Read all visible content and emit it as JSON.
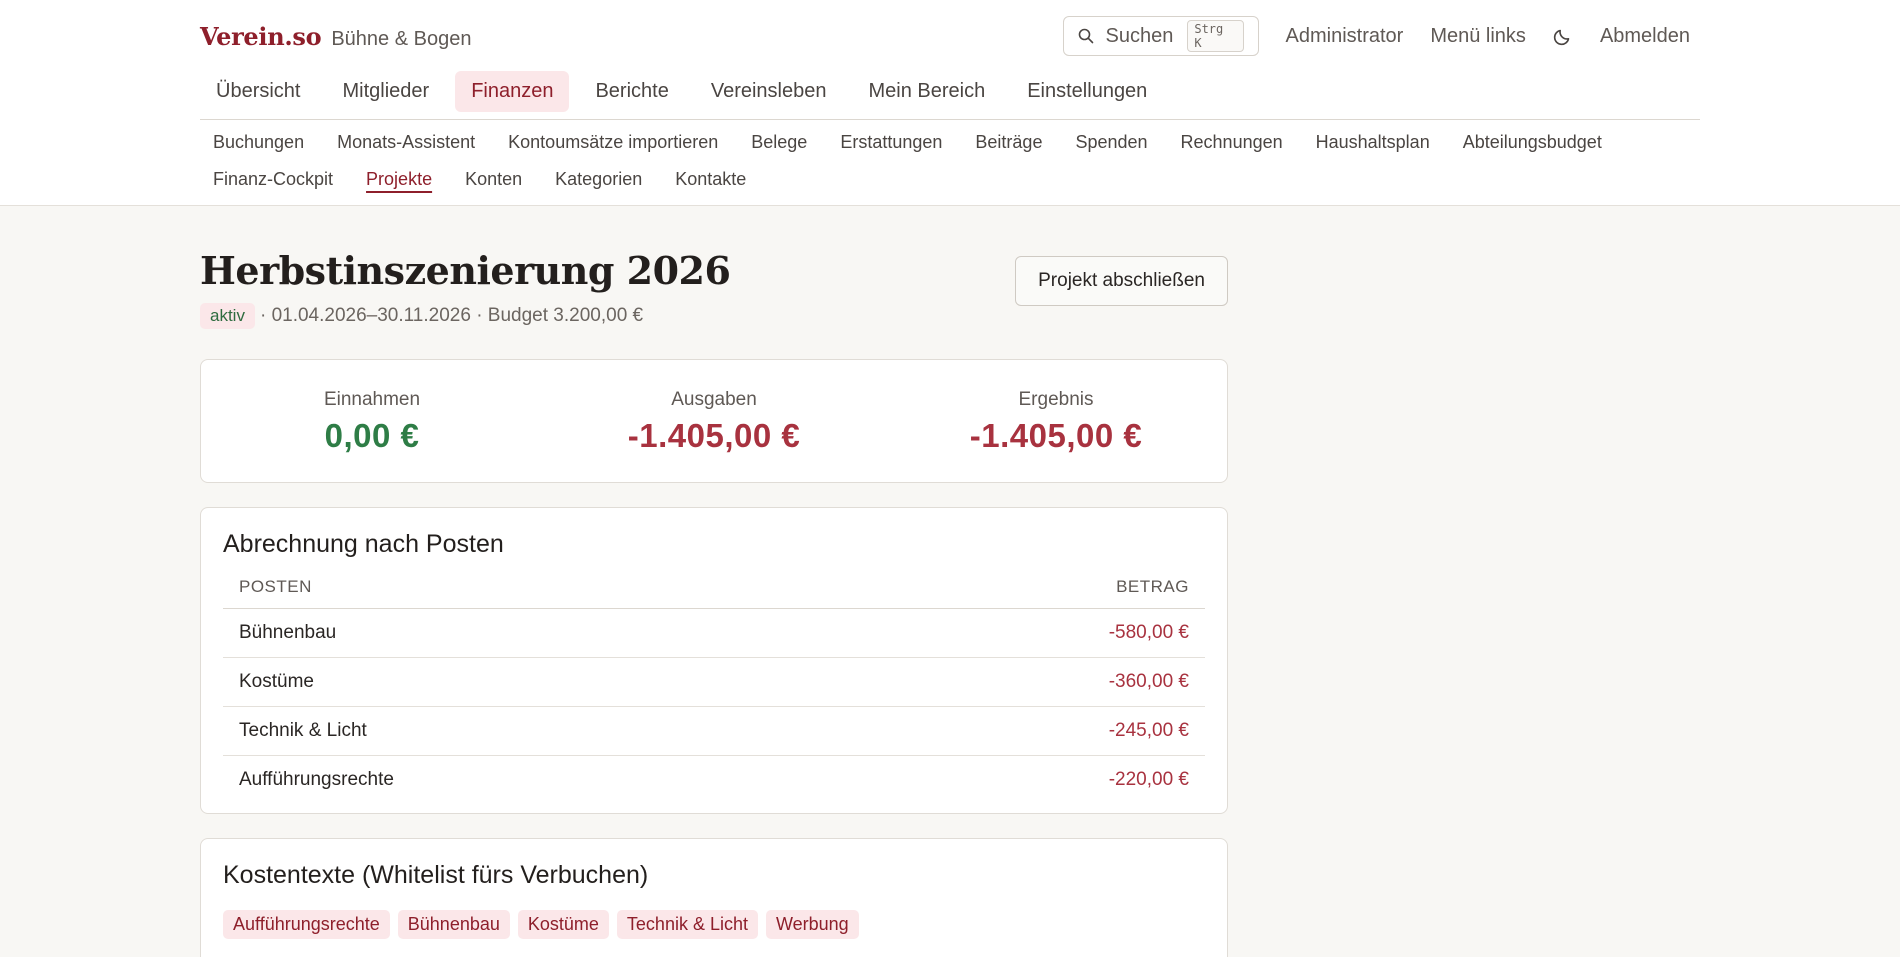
{
  "brand": {
    "logo": "Verein.so",
    "org": "Bühne & Bogen"
  },
  "header": {
    "search_label": "Suchen",
    "search_shortcut": "Strg K",
    "admin": "Administrator",
    "menu_left": "Menü links",
    "logout": "Abmelden"
  },
  "main_nav": [
    {
      "label": "Übersicht"
    },
    {
      "label": "Mitglieder"
    },
    {
      "label": "Finanzen",
      "active": true
    },
    {
      "label": "Berichte"
    },
    {
      "label": "Vereinsleben"
    },
    {
      "label": "Mein Bereich"
    },
    {
      "label": "Einstellungen"
    }
  ],
  "sub_nav": [
    {
      "label": "Buchungen"
    },
    {
      "label": "Monats-Assistent"
    },
    {
      "label": "Kontoumsätze importieren"
    },
    {
      "label": "Belege"
    },
    {
      "label": "Erstattungen"
    },
    {
      "label": "Beiträge"
    },
    {
      "label": "Spenden"
    },
    {
      "label": "Rechnungen"
    },
    {
      "label": "Haushaltsplan"
    },
    {
      "label": "Abteilungsbudget"
    },
    {
      "label": "Finanz-Cockpit"
    },
    {
      "label": "Projekte",
      "active": true
    },
    {
      "label": "Konten"
    },
    {
      "label": "Kategorien"
    },
    {
      "label": "Kontakte"
    }
  ],
  "project": {
    "title": "Herbstinszenierung 2026",
    "status": "aktiv",
    "meta": "· 01.04.2026–30.11.2026 · Budget 3.200,00 €",
    "close_button": "Projekt abschließen"
  },
  "summary": {
    "income_label": "Einnahmen",
    "income_value": "0,00 €",
    "expenses_label": "Ausgaben",
    "expenses_value": "-1.405,00 €",
    "result_label": "Ergebnis",
    "result_value": "-1.405,00 €"
  },
  "breakdown": {
    "title": "Abrechnung nach Posten",
    "col_item": "POSTEN",
    "col_amount": "BETRAG",
    "rows": [
      {
        "item": "Bühnenbau",
        "amount": "-580,00 €"
      },
      {
        "item": "Kostüme",
        "amount": "-360,00 €"
      },
      {
        "item": "Technik & Licht",
        "amount": "-245,00 €"
      },
      {
        "item": "Aufführungsrechte",
        "amount": "-220,00 €"
      }
    ]
  },
  "cost_texts": {
    "title": "Kostentexte (Whitelist fürs Verbuchen)",
    "tags": [
      "Aufführungsrechte",
      "Bühnenbau",
      "Kostüme",
      "Technik & Licht",
      "Werbung"
    ]
  },
  "icons": {
    "search": "search-icon",
    "theme": "moon-icon"
  },
  "colors": {
    "accent": "#8e1f2b",
    "positive": "#2e7d46",
    "negative": "#a8323f",
    "active_bg": "#fbe7e9"
  }
}
